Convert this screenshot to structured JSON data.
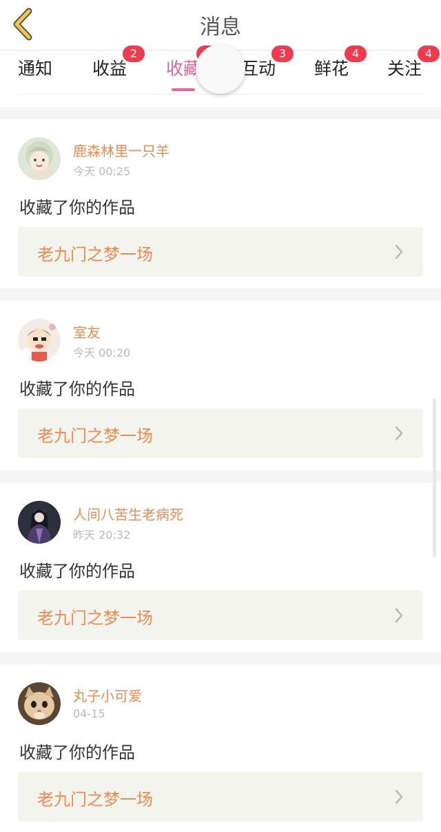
{
  "header": {
    "title": "消息"
  },
  "tabs": [
    {
      "label": "通知",
      "badge": ""
    },
    {
      "label": "收益",
      "badge": "2"
    },
    {
      "label": "收藏",
      "badge": "",
      "active": true
    },
    {
      "label": "互动",
      "badge": "3"
    },
    {
      "label": "鲜花",
      "badge": "4"
    },
    {
      "label": "关注",
      "badge": "4"
    }
  ],
  "notifications": [
    {
      "user": "鹿森林里一只羊",
      "time": "今天 00:25",
      "action": "收藏了你的作品",
      "work": "老九门之梦一场"
    },
    {
      "user": "室友",
      "time": "今天 00:20",
      "action": "收藏了你的作品",
      "work": "老九门之梦一场"
    },
    {
      "user": "人间八苦生老病死",
      "time": "昨天 20:32",
      "action": "收藏了你的作品",
      "work": "老九门之梦一场"
    },
    {
      "user": "丸子小可爱",
      "time": "04-15",
      "action": "收藏了你的作品",
      "work": "老九门之梦一场"
    }
  ],
  "colors": {
    "accent": "#e8649a",
    "badge": "#f23a4e",
    "username": "#f08a50",
    "card_bg": "#f4f4ee"
  },
  "icons": {
    "back": "chevron-left-icon",
    "row_arrow": "chevron-right-icon"
  }
}
